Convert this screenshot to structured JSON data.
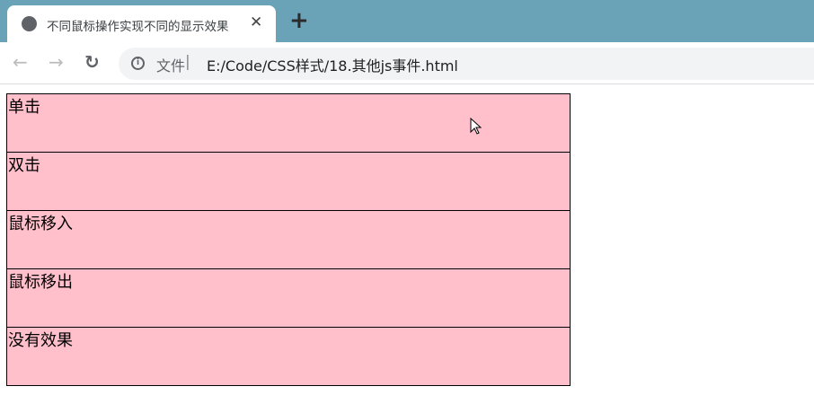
{
  "tab": {
    "title": "不同鼠标操作实现不同的显示效果",
    "close": "✕",
    "new_tab": "+"
  },
  "toolbar": {
    "back": "←",
    "forward": "→",
    "reload": "↻",
    "security_label": "文件",
    "separator": "|",
    "url": "E:/Code/CSS样式/18.其他js事件.html"
  },
  "boxes": [
    {
      "label": "单击"
    },
    {
      "label": "双击"
    },
    {
      "label": "鼠标移入"
    },
    {
      "label": "鼠标移出"
    },
    {
      "label": "没有效果"
    }
  ],
  "colors": {
    "box_bg": "#ffc0cb",
    "tabbar": "#6aa3b8"
  }
}
